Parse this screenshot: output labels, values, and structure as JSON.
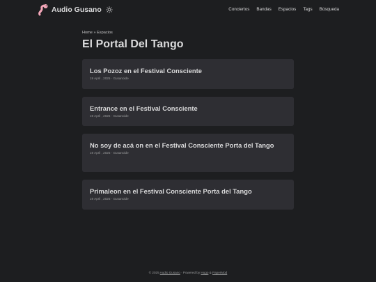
{
  "header": {
    "site_title": "Audio Gusano",
    "nav": [
      "Conciertos",
      "Bandas",
      "Espacios",
      "Tags",
      "Búsqueda"
    ]
  },
  "breadcrumb": {
    "home": "Home",
    "sep": " » ",
    "section": "Espacios"
  },
  "page_title": "El Portal Del Tango",
  "posts": [
    {
      "title": "Los Pozoz en el Festival Consciente",
      "meta": "19 April , 2025 · Gusanoide"
    },
    {
      "title": "Entrance en el Festival Consciente",
      "meta": "19 April , 2025 · Gusanoide"
    },
    {
      "title": "No soy de acá on en el Festival Consciente Porta del Tango",
      "meta": "19 April , 2025 · Gusanoide"
    },
    {
      "title": "Primaleon en el Festival Consciente Porta del Tango",
      "meta": "19 April , 2025 · Gusanoide"
    }
  ],
  "footer": {
    "copyright": "© 2025 ",
    "site_link": "Audio Gusano",
    "powered": " · Powered by ",
    "hugo": "Hugo",
    "amp": " & ",
    "papermod": "PaperMod"
  },
  "colors": {
    "background": "#1d1e20",
    "card": "#2e2e33",
    "text": "#dadadb",
    "muted": "#9b9c9d",
    "logo": "#f4a7b9"
  },
  "icons": {
    "logo": "worm-logo-icon",
    "theme_toggle": "sun-icon"
  }
}
